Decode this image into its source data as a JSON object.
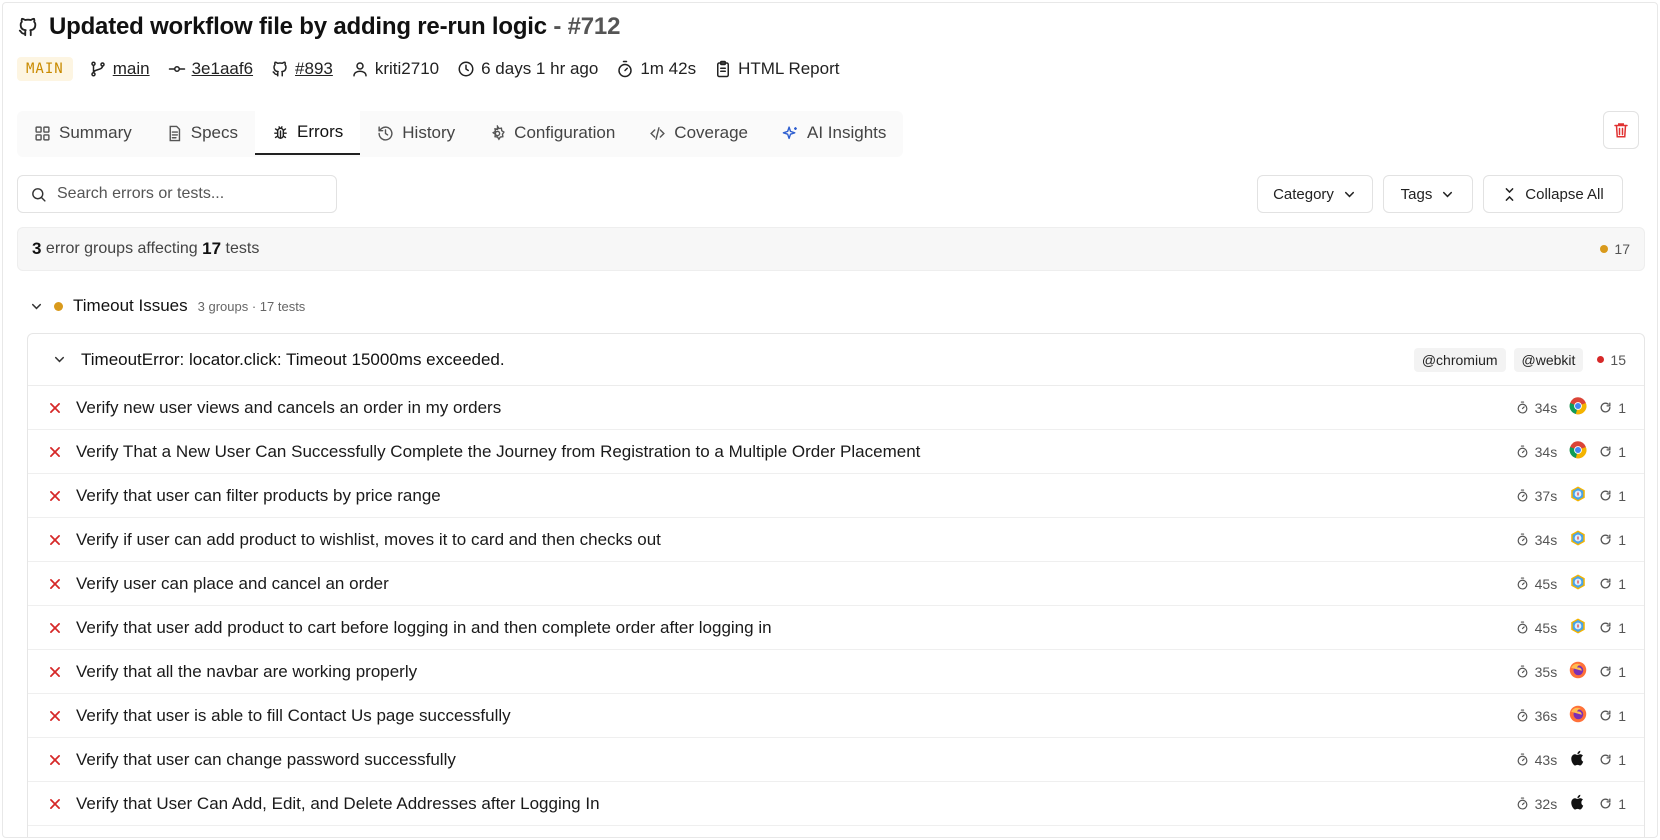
{
  "header": {
    "title": "Updated workflow file by adding re-run logic",
    "separator": " - ",
    "run_number": "#712"
  },
  "meta": {
    "branch_badge": "MAIN",
    "branch": "main",
    "commit": "3e1aaf6",
    "pr": "#893",
    "author": "kriti2710",
    "time_ago": "6 days 1 hr ago",
    "duration": "1m 42s",
    "report": "HTML Report"
  },
  "tabs": [
    {
      "label": "Summary",
      "icon": "grid-icon"
    },
    {
      "label": "Specs",
      "icon": "file-icon"
    },
    {
      "label": "Errors",
      "icon": "bug-icon",
      "active": true
    },
    {
      "label": "History",
      "icon": "history-icon"
    },
    {
      "label": "Configuration",
      "icon": "gear-icon"
    },
    {
      "label": "Coverage",
      "icon": "code-icon"
    },
    {
      "label": "AI Insights",
      "icon": "sparkle-icon"
    }
  ],
  "filters": {
    "search_placeholder": "Search errors or tests...",
    "category": "Category",
    "tags": "Tags",
    "collapse": "Collapse All"
  },
  "summary": {
    "groups": "3",
    "text1": " error groups affecting ",
    "tests": "17",
    "text2": " tests",
    "count": "17"
  },
  "category": {
    "title": "Timeout Issues",
    "sub": "3 groups · 17 tests"
  },
  "group": {
    "title": "TimeoutError: locator.click: Timeout 15000ms exceeded.",
    "tags": [
      "@chromium",
      "@webkit"
    ],
    "count": "15"
  },
  "tests": [
    {
      "name": "Verify new user views and cancels an order in my orders",
      "time": "34s",
      "browser": "chrome",
      "retries": "1"
    },
    {
      "name": "Verify That a New User Can Successfully Complete the Journey from Registration to a Multiple Order Placement",
      "time": "34s",
      "browser": "chrome",
      "retries": "1"
    },
    {
      "name": "Verify that user can filter products by price range",
      "time": "37s",
      "browser": "webkit",
      "retries": "1"
    },
    {
      "name": "Verify if user can add product to wishlist, moves it to card and then checks out",
      "time": "34s",
      "browser": "webkit",
      "retries": "1"
    },
    {
      "name": "Verify user can place and cancel an order",
      "time": "45s",
      "browser": "webkit",
      "retries": "1"
    },
    {
      "name": "Verify that user add product to cart before logging in and then complete order after logging in",
      "time": "45s",
      "browser": "webkit",
      "retries": "1"
    },
    {
      "name": "Verify that all the navbar are working properly",
      "time": "35s",
      "browser": "firefox",
      "retries": "1"
    },
    {
      "name": "Verify that user is able to fill Contact Us page successfully",
      "time": "36s",
      "browser": "firefox",
      "retries": "1"
    },
    {
      "name": "Verify that user can change password successfully",
      "time": "43s",
      "browser": "apple",
      "retries": "1"
    },
    {
      "name": "Verify that User Can Add, Edit, and Delete Addresses after Logging In",
      "time": "32s",
      "browser": "apple",
      "retries": "1"
    }
  ],
  "colors": {
    "timeout_dot": "#d99a1c",
    "error_dot": "#d62828",
    "fail_x": "#d62828",
    "delete": "#e03131"
  }
}
